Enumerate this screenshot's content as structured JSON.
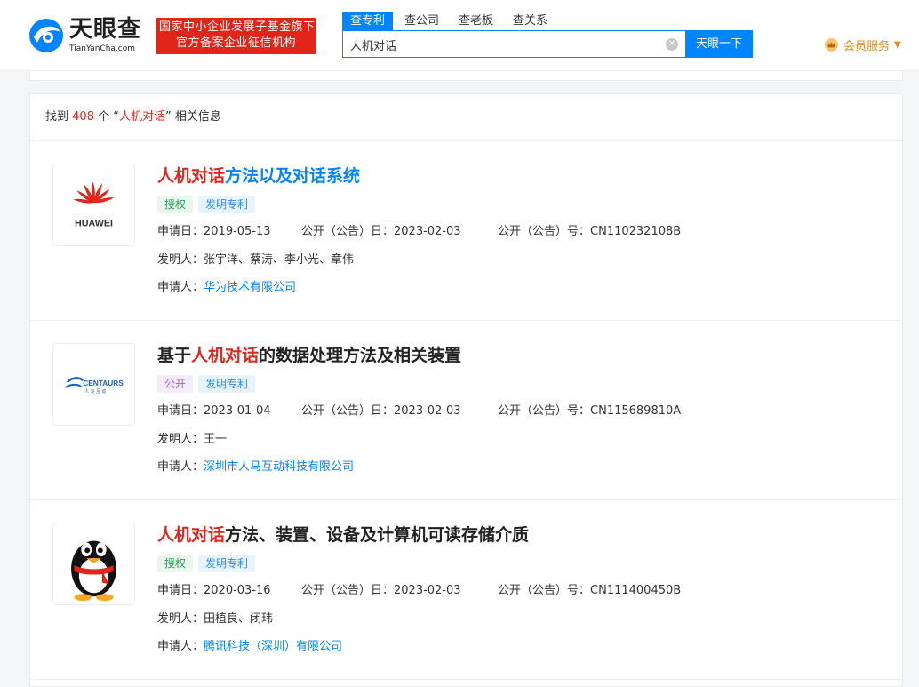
{
  "header": {
    "logo_name": "天眼查",
    "logo_sub": "TianYanCha.com",
    "badge_line1": "国家中小企业发展子基金旗下",
    "badge_line2": "官方备案企业征信机构",
    "search_tabs": [
      {
        "label": "查专利",
        "active": true
      },
      {
        "label": "查公司",
        "active": false
      },
      {
        "label": "查老板",
        "active": false
      },
      {
        "label": "查关系",
        "active": false
      }
    ],
    "search_value": "人机对话",
    "search_button": "天眼一下",
    "vip_label": "会员服务"
  },
  "summary": {
    "prefix": "找到",
    "count": "408",
    "middle": "个 “",
    "keyword": "人机对话",
    "suffix": "” 相关信息"
  },
  "results": [
    {
      "title_hl": "人机对话",
      "title_rest": "方法以及对话系统",
      "title_pre": "",
      "tags": [
        "授权",
        "发明专利"
      ],
      "apply_date_label": "申请日：",
      "apply_date": "2019-05-13",
      "pub_date_label": "公开（公告）日：",
      "pub_date": "2023-02-03",
      "pub_no_label": "公开（公告）号：",
      "pub_no": "CN110232108B",
      "inventor_label": "发明人：",
      "inventors": "张宇洋、蔡涛、李小光、章伟",
      "applicant_label": "申请人：",
      "applicant": "华为技术有限公司",
      "logo_text": "HUAWEI"
    },
    {
      "title_pre": "基于",
      "title_hl": "人机对话",
      "title_rest": "的数据处理方法及相关装置",
      "tags": [
        "公开",
        "发明专利"
      ],
      "apply_date_label": "申请日：",
      "apply_date": "2023-01-04",
      "pub_date_label": "公开（公告）日：",
      "pub_date": "2023-02-03",
      "pub_no_label": "公开（公告）号：",
      "pub_no": "CN115689810A",
      "inventor_label": "发明人：",
      "inventors": "王一",
      "applicant_label": "申请人：",
      "applicant": "深圳市人马互动科技有限公司",
      "logo_text": "CENTAURS",
      "logo_sub": "人 马 互 动"
    },
    {
      "title_pre": "",
      "title_hl": "人机对话",
      "title_rest": "方法、装置、设备及计算机可读存储介质",
      "tags": [
        "授权",
        "发明专利"
      ],
      "apply_date_label": "申请日：",
      "apply_date": "2020-03-16",
      "pub_date_label": "公开（公告）日：",
      "pub_date": "2023-02-03",
      "pub_no_label": "公开（公告）号：",
      "pub_no": "CN111400450B",
      "inventor_label": "发明人：",
      "inventors": "田植良、闭玮",
      "applicant_label": "申请人：",
      "applicant": "腾讯科技（深圳）有限公司"
    }
  ],
  "colors": {
    "brand_blue": "#0084ff",
    "highlight_red": "#e1251b",
    "vip_orange": "#e48a1a"
  }
}
